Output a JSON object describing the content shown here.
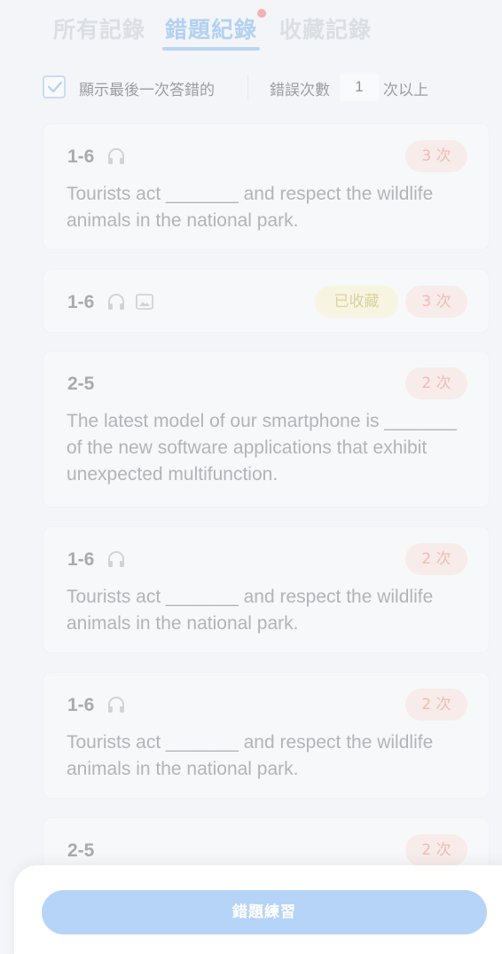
{
  "tabs": [
    {
      "label": "所有記錄"
    },
    {
      "label": "錯題紀錄"
    },
    {
      "label": "收藏記錄"
    }
  ],
  "filter": {
    "checkbox_label": "顯示最後一次答錯的",
    "count_label": "錯誤次數",
    "count_value": "1",
    "count_suffix": "次以上"
  },
  "cards": [
    {
      "title": "1-6",
      "badge": "3 次",
      "text": "Tourists act _______ and respect the wildlife animals in the national park."
    },
    {
      "title": "1-6",
      "fav": "已收藏",
      "badge": "3 次"
    },
    {
      "title": "2-5",
      "badge": "2 次",
      "text": "The latest model of our smartphone is _______ of the new software applications that exhibit unexpected multifunction."
    },
    {
      "title": "1-6",
      "badge": "2 次",
      "text": "Tourists act _______ and respect the wildlife animals in the national park."
    },
    {
      "title": "1-6",
      "badge": "2 次",
      "text": "Tourists act _______ and respect the wildlife animals in the national park."
    },
    {
      "title": "2-5",
      "badge": "2 次"
    }
  ],
  "practice_button": "錯題練習",
  "colors": {
    "accent": "#7fb4ee",
    "badge_count": "#f08c72",
    "badge_fav": "#c8b45a",
    "tab_dot": "#f07c7c"
  }
}
